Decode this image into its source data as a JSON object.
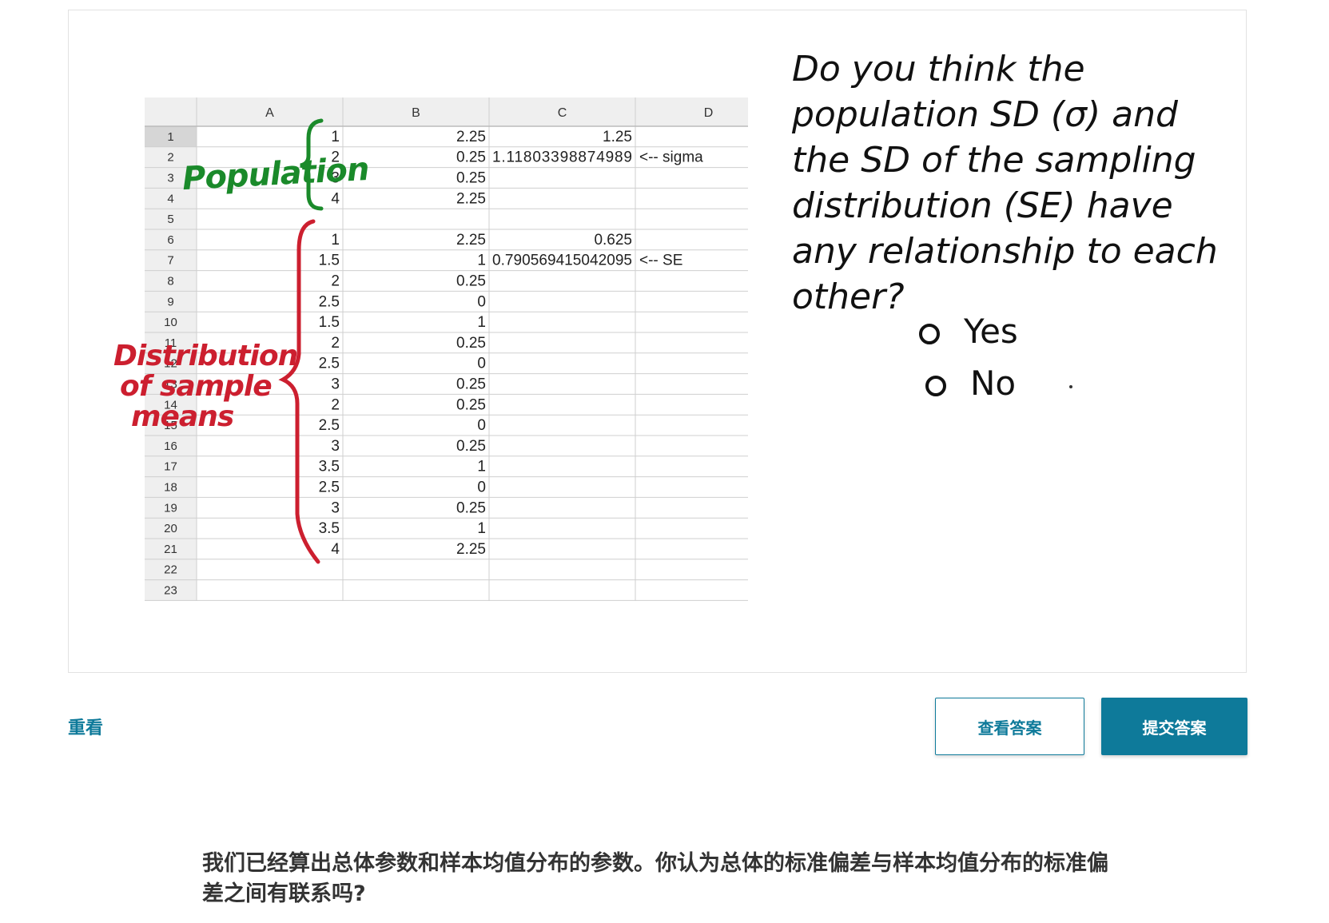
{
  "spreadsheet": {
    "columns": [
      "A",
      "B",
      "C",
      "D"
    ],
    "rows": [
      {
        "n": "1",
        "a": "1",
        "b": "2.25",
        "c": "1.25",
        "d": ""
      },
      {
        "n": "2",
        "a": "2",
        "b": "0.25",
        "c": "1.11803398874989",
        "d": "<-- sigma"
      },
      {
        "n": "3",
        "a": "3",
        "b": "0.25",
        "c": "",
        "d": ""
      },
      {
        "n": "4",
        "a": "4",
        "b": "2.25",
        "c": "",
        "d": ""
      },
      {
        "n": "5",
        "a": "",
        "b": "",
        "c": "",
        "d": ""
      },
      {
        "n": "6",
        "a": "1",
        "b": "2.25",
        "c": "0.625",
        "d": ""
      },
      {
        "n": "7",
        "a": "1.5",
        "b": "1",
        "c": "0.790569415042095",
        "d": "<-- SE"
      },
      {
        "n": "8",
        "a": "2",
        "b": "0.25",
        "c": "",
        "d": ""
      },
      {
        "n": "9",
        "a": "2.5",
        "b": "0",
        "c": "",
        "d": ""
      },
      {
        "n": "10",
        "a": "1.5",
        "b": "1",
        "c": "",
        "d": ""
      },
      {
        "n": "11",
        "a": "2",
        "b": "0.25",
        "c": "",
        "d": ""
      },
      {
        "n": "12",
        "a": "2.5",
        "b": "0",
        "c": "",
        "d": ""
      },
      {
        "n": "13",
        "a": "3",
        "b": "0.25",
        "c": "",
        "d": ""
      },
      {
        "n": "14",
        "a": "2",
        "b": "0.25",
        "c": "",
        "d": ""
      },
      {
        "n": "15",
        "a": "2.5",
        "b": "0",
        "c": "",
        "d": ""
      },
      {
        "n": "16",
        "a": "3",
        "b": "0.25",
        "c": "",
        "d": ""
      },
      {
        "n": "17",
        "a": "3.5",
        "b": "1",
        "c": "",
        "d": ""
      },
      {
        "n": "18",
        "a": "2.5",
        "b": "0",
        "c": "",
        "d": ""
      },
      {
        "n": "19",
        "a": "3",
        "b": "0.25",
        "c": "",
        "d": ""
      },
      {
        "n": "20",
        "a": "3.5",
        "b": "1",
        "c": "",
        "d": ""
      },
      {
        "n": "21",
        "a": "4",
        "b": "2.25",
        "c": "",
        "d": ""
      },
      {
        "n": "22",
        "a": "",
        "b": "",
        "c": "",
        "d": ""
      },
      {
        "n": "23",
        "a": "",
        "b": "",
        "c": "",
        "d": ""
      }
    ]
  },
  "annotations": {
    "population": "Population",
    "distribution": [
      "Distribution",
      "of sample",
      "means"
    ],
    "population_color": "#1a8a2a",
    "distribution_color": "#cc1f2f"
  },
  "question": {
    "lines": [
      "Do you think the",
      "population SD (σ) and",
      "the SD of the sampling",
      "distribution (SE) have",
      "any relationship to each",
      "other?"
    ],
    "options": [
      "Yes",
      "No"
    ]
  },
  "controls": {
    "rewatch": "重看",
    "view_answer": "查看答案",
    "submit_answer": "提交答案",
    "accent_color": "#0e7a9a"
  },
  "caption": "我们已经算出总体参数和样本均值分布的参数。你认为总体的标准偏差与样本均值分布的标准偏差之间有联系吗?"
}
